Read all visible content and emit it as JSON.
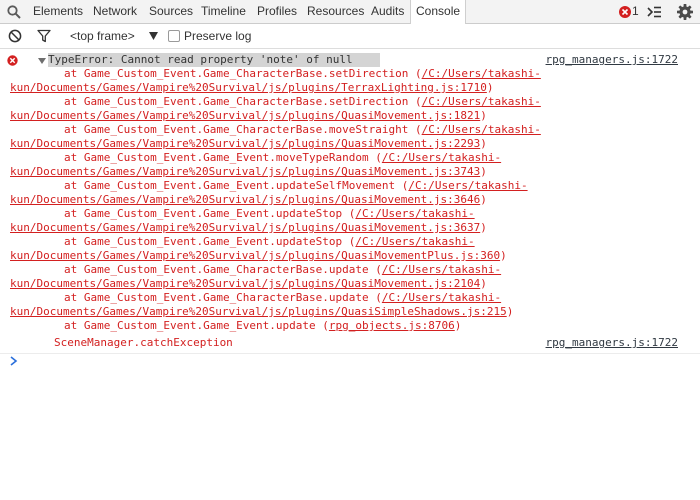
{
  "tabs": [
    {
      "label": "Elements"
    },
    {
      "label": "Network"
    },
    {
      "label": "Sources"
    },
    {
      "label": "Timeline"
    },
    {
      "label": "Profiles"
    },
    {
      "label": "Resources"
    },
    {
      "label": "Audits"
    },
    {
      "label": "Console"
    }
  ],
  "header": {
    "error_count": "1",
    "accent": "#d32020"
  },
  "toolbar": {
    "frame_selector": "<top frame>",
    "preserve_log_label": "Preserve log",
    "preserve_log_checked": false
  },
  "console": {
    "error": {
      "message": "TypeError: Cannot read property 'note' of null",
      "source": "rpg_managers.js:1722",
      "trace": [
        {
          "prefix": "at Game_Custom_Event.Game_CharacterBase.setDirection (",
          "link_a": "/C:/Users/takashi-",
          "link_b": "kun/Documents/Games/Vampire%20Survival/js/plugins/TerraxLighting.js:1710",
          "suffix": ")"
        },
        {
          "prefix": "at Game_Custom_Event.Game_CharacterBase.setDirection (",
          "link_a": "/C:/Users/takashi-",
          "link_b": "kun/Documents/Games/Vampire%20Survival/js/plugins/QuasiMovement.js:1821",
          "suffix": ")"
        },
        {
          "prefix": "at Game_Custom_Event.Game_CharacterBase.moveStraight (",
          "link_a": "/C:/Users/takashi-",
          "link_b": "kun/Documents/Games/Vampire%20Survival/js/plugins/QuasiMovement.js:2293",
          "suffix": ")"
        },
        {
          "prefix": "at Game_Custom_Event.Game_Event.moveTypeRandom (",
          "link_a": "/C:/Users/takashi-",
          "link_b": "kun/Documents/Games/Vampire%20Survival/js/plugins/QuasiMovement.js:3743",
          "suffix": ")"
        },
        {
          "prefix": "at Game_Custom_Event.Game_Event.updateSelfMovement (",
          "link_a": "/C:/Users/takashi-",
          "link_b": "kun/Documents/Games/Vampire%20Survival/js/plugins/QuasiMovement.js:3646",
          "suffix": ")"
        },
        {
          "prefix": "at Game_Custom_Event.Game_Event.updateStop (",
          "link_a": "/C:/Users/takashi-",
          "link_b": "kun/Documents/Games/Vampire%20Survival/js/plugins/QuasiMovement.js:3637",
          "suffix": ")"
        },
        {
          "prefix": "at Game_Custom_Event.Game_Event.updateStop (",
          "link_a": "/C:/Users/takashi-",
          "link_b": "kun/Documents/Games/Vampire%20Survival/js/plugins/QuasiMovementPlus.js:360",
          "suffix": ")"
        },
        {
          "prefix": "at Game_Custom_Event.Game_CharacterBase.update (",
          "link_a": "/C:/Users/takashi-",
          "link_b": "kun/Documents/Games/Vampire%20Survival/js/plugins/QuasiMovement.js:2104",
          "suffix": ")"
        },
        {
          "prefix": "at Game_Custom_Event.Game_CharacterBase.update (",
          "link_a": "/C:/Users/takashi-",
          "link_b": "kun/Documents/Games/Vampire%20Survival/js/plugins/QuasiSimpleShadows.js:215",
          "suffix": ")"
        }
      ],
      "last_frame": {
        "prefix": "at Game_Custom_Event.Game_Event.update (",
        "link": "rpg_objects.js:8706",
        "suffix": ")"
      }
    },
    "log": {
      "message": "SceneManager.catchException",
      "source": "rpg_managers.js:1722"
    }
  }
}
